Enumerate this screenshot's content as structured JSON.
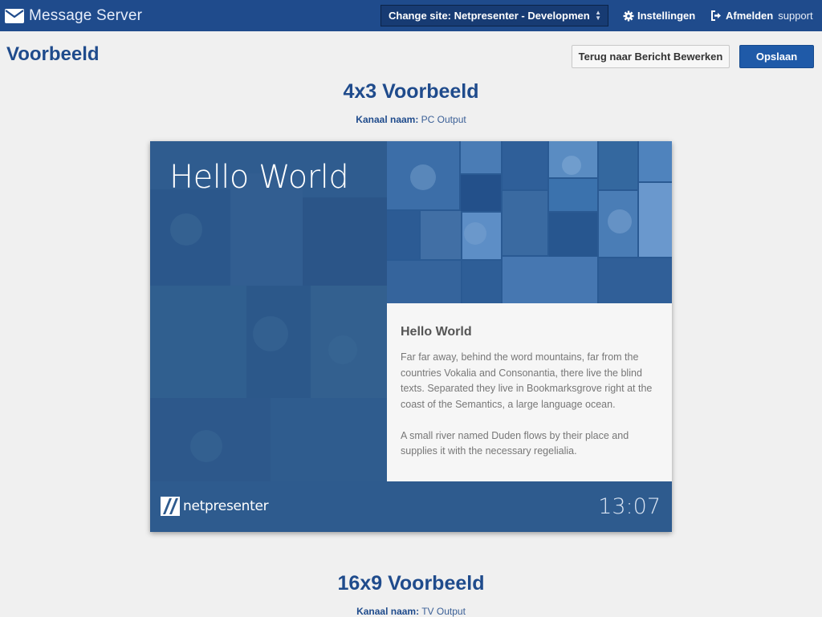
{
  "app": {
    "title": "Message Server",
    "site_select": "Change site: Netpresenter - Development...",
    "nav": {
      "settings": "Instellingen",
      "logout": "Afmelden",
      "user": "support"
    }
  },
  "header": {
    "title": "Voorbeeld",
    "back_button": "Terug naar Bericht Bewerken",
    "save_button": "Opslaan"
  },
  "previews": [
    {
      "title": "4x3 Voorbeeld",
      "channel_label": "Kanaal naam:",
      "channel_value": "PC Output",
      "slide": {
        "headline": "Hello World",
        "card_title": "Hello World",
        "paragraphs": [
          "Far far away, behind the word mountains, far from the countries Vokalia and Consonantia, there live the blind texts. Separated they live in Bookmarksgrove right at the coast of the Semantics, a large language ocean.",
          "A small river named Duden flows by their place and supplies it with the necessary regelialia."
        ],
        "logo_text": "netpresenter",
        "clock": "13:07"
      }
    },
    {
      "title": "16x9 Voorbeeld",
      "channel_label": "Kanaal naam:",
      "channel_value": "TV Output"
    }
  ],
  "colors": {
    "topbar": "#1f4b8c",
    "accent": "#1f5aa8",
    "slide_blue": "#2e5b8e"
  }
}
